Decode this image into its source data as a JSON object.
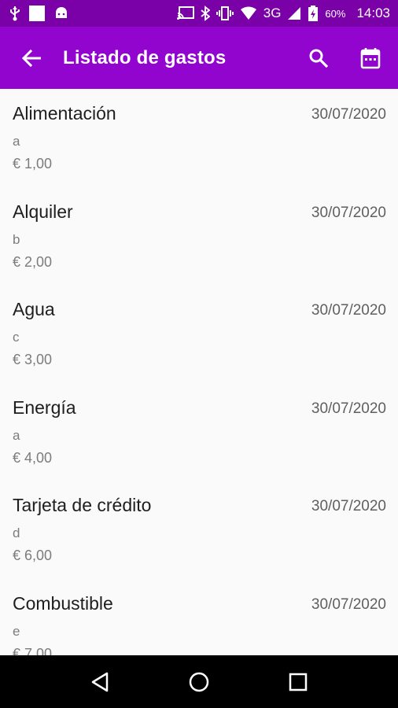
{
  "status_bar": {
    "battery_percent": "60%",
    "network": "3G",
    "time": "14:03"
  },
  "app_bar": {
    "title": "Listado de gastos"
  },
  "expenses": [
    {
      "name": "Alimentación",
      "date": "30/07/2020",
      "sub": "a",
      "amount": "€ 1,00"
    },
    {
      "name": "Alquiler",
      "date": "30/07/2020",
      "sub": "b",
      "amount": "€ 2,00"
    },
    {
      "name": "Agua",
      "date": "30/07/2020",
      "sub": "c",
      "amount": "€ 3,00"
    },
    {
      "name": "Energía",
      "date": "30/07/2020",
      "sub": "a",
      "amount": "€ 4,00"
    },
    {
      "name": "Tarjeta de crédito",
      "date": "30/07/2020",
      "sub": "d",
      "amount": "€ 6,00"
    },
    {
      "name": "Combustible",
      "date": "30/07/2020",
      "sub": "e",
      "amount": "€ 7,00"
    }
  ],
  "colors": {
    "status_bar": "#7a00a8",
    "app_bar": "#9105cf",
    "background": "#fafafa"
  }
}
